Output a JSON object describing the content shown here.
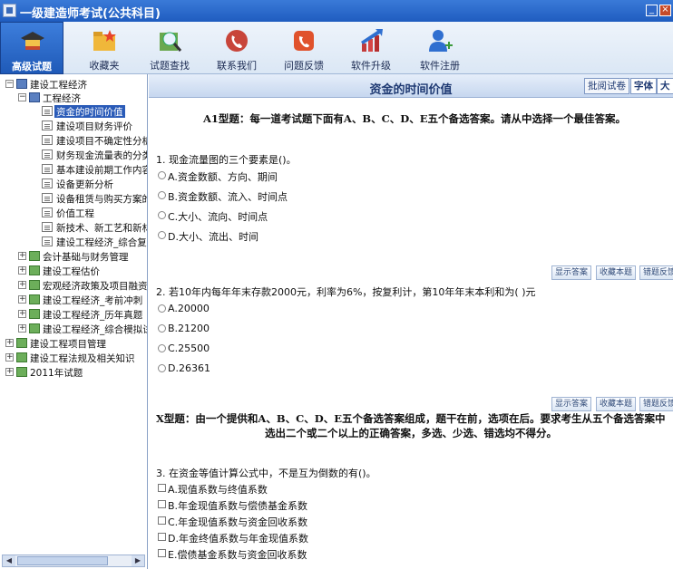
{
  "window": {
    "title": "一级建造师考试(公共科目)"
  },
  "toolbar": {
    "items": [
      {
        "label": "高级试题",
        "icon": "graduation-cap-icon",
        "active": true
      },
      {
        "label": "收藏夹",
        "icon": "folder-star-icon"
      },
      {
        "label": "试题查找",
        "icon": "magnifier-icon"
      },
      {
        "label": "联系我们",
        "icon": "phone-icon"
      },
      {
        "label": "问题反馈",
        "icon": "feedback-icon"
      },
      {
        "label": "软件升级",
        "icon": "upgrade-arrow-icon"
      },
      {
        "label": "软件注册",
        "icon": "user-add-icon"
      }
    ]
  },
  "sidebar": {
    "tree": [
      {
        "label": "建设工程经济"
      },
      {
        "label": "工程经济"
      },
      {
        "label": "资金的时间价值"
      },
      {
        "label": "建设项目财务评价"
      },
      {
        "label": "建设项目不确定性分析"
      },
      {
        "label": "财务现金流量表的分类与"
      },
      {
        "label": "基本建设前期工作内容"
      },
      {
        "label": "设备更新分析"
      },
      {
        "label": "设备租赁与购买方案的比"
      },
      {
        "label": "价值工程"
      },
      {
        "label": "新技术、新工艺和新材料"
      },
      {
        "label": "建设工程经济_综合复习"
      },
      {
        "label": "会计基础与财务管理"
      },
      {
        "label": "建设工程估价"
      },
      {
        "label": "宏观经济政策及项目融资"
      },
      {
        "label": "建设工程经济_考前冲刺"
      },
      {
        "label": "建设工程经济_历年真题"
      },
      {
        "label": "建设工程经济_综合模拟试题"
      },
      {
        "label": "建设工程项目管理"
      },
      {
        "label": "建设工程法规及相关知识"
      },
      {
        "label": "2011年试题"
      }
    ]
  },
  "main": {
    "title": "资金的时间价值",
    "buttons": {
      "review": "批阅试卷",
      "font": "字体",
      "large": "大"
    },
    "section_a1": "A1型题：每一道考试题下面有A、B、C、D、E五个备选答案。请从中选择一个最佳答案。",
    "q1": {
      "text": "1. 现金流量图的三个要素是()。",
      "options": [
        "A.资金数额、方向、期间",
        "B.资金数额、流入、时间点",
        "C.大小、流向、时间点",
        "D.大小、流出、时间"
      ]
    },
    "q2": {
      "text": "2. 若10年内每年年末存款2000元，利率为6%，按复利计，第10年年末本利和为(    )元",
      "options": [
        "A.20000",
        "B.21200",
        "C.25500",
        "D.26361"
      ]
    },
    "actions": {
      "show_answer": "显示答案",
      "favorite": "收藏本题",
      "error_report": "错题反馈"
    },
    "section_x_line1": "X型题：由一个提供和A、B、C、D、E五个备选答案组成，题干在前，选项在后。要求考生从五个备选答案中",
    "section_x_line2": "选出二个或二个以上的正确答案，多选、少选、错选均不得分。",
    "q3": {
      "text": "3. 在资金等值计算公式中，不是互为倒数的有()。",
      "options": [
        "A.现值系数与终值系数",
        "B.年金现值系数与偿债基金系数",
        "C.年金现值系数与资金回收系数",
        "D.年金终值系数与年金现值系数",
        "E.偿债基金系数与资金回收系数"
      ]
    }
  },
  "colors": {
    "titlebar": "#1f5cbf",
    "selected": "#2a5bb8",
    "accent": "#1f3a73"
  }
}
